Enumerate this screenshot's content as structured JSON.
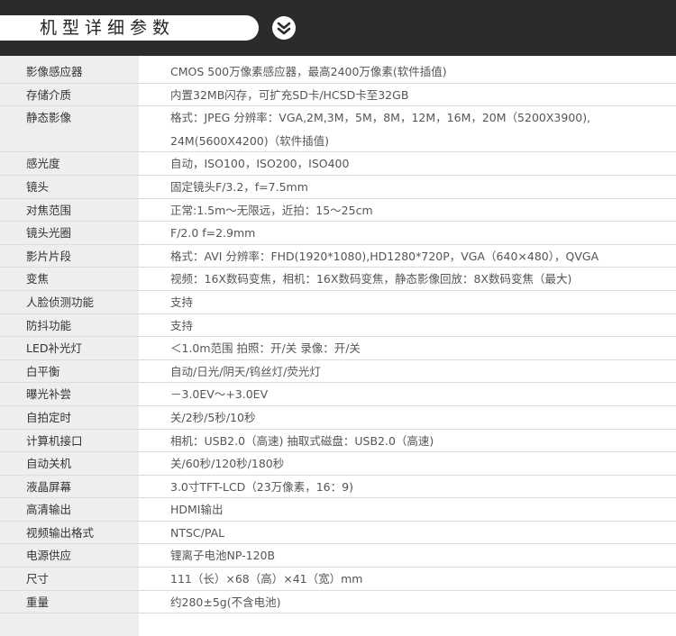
{
  "header": {
    "title": "机型详细参数",
    "chevron_icon": "double-chevron-down-icon"
  },
  "specs": [
    {
      "label": "影像感应器",
      "value": "CMOS 500万像素感应器，最高2400万像素(软件插值)"
    },
    {
      "label": "存储介质",
      "value": "内置32MB闪存，可扩充SD卡/HCSD卡至32GB"
    },
    {
      "label": "静态影像",
      "value": "格式：JPEG  分辨率：VGA,2M,3M，5M，8M，12M，16M，20M（5200X3900),\n24M(5600X4200)（软件插值)"
    },
    {
      "label": "感光度",
      "value": "自动，ISO100，ISO200，ISO400"
    },
    {
      "label": "镜头",
      "value": "固定镜头F/3.2，f=7.5mm"
    },
    {
      "label": "对焦范围",
      "value": "正常:1.5m～无限远，近拍：15～25cm"
    },
    {
      "label": "镜头光圈",
      "value": "F/2.0 f=2.9mm"
    },
    {
      "label": "影片片段",
      "value": "格式：AVI  分辨率：FHD(1920*1080),HD1280*720P，VGA（640×480），QVGA"
    },
    {
      "label": "变焦",
      "value": "视频：16X数码变焦，相机：16X数码变焦，静态影像回放：8X数码变焦（最大)"
    },
    {
      "label": "人脸侦测功能",
      "value": "支持"
    },
    {
      "label": "防抖功能",
      "value": "支持"
    },
    {
      "label": "LED补光灯",
      "value": "＜1.0m范围  拍照：开/关   录像：开/关"
    },
    {
      "label": "白平衡",
      "value": "自动/日光/阴天/钨丝灯/荧光灯"
    },
    {
      "label": "曝光补尝",
      "value": "－3.0EV～+3.0EV"
    },
    {
      "label": "自拍定时",
      "value": "关/2秒/5秒/10秒"
    },
    {
      "label": "计算机接口",
      "value": "相机：USB2.0（高速)  抽取式磁盘：USB2.0（高速)"
    },
    {
      "label": "自动关机",
      "value": "关/60秒/120秒/180秒"
    },
    {
      "label": "液晶屏幕",
      "value": "3.0寸TFT-LCD（23万像素，16：9)"
    },
    {
      "label": "高清输出",
      "value": "HDMI输出"
    },
    {
      "label": "视频输出格式",
      "value": "NTSC/PAL"
    },
    {
      "label": "电源供应",
      "value": "锂离子电池NP-120B"
    },
    {
      "label": "尺寸",
      "value": "111（长）×68（高）×41（宽）mm"
    },
    {
      "label": "重量",
      "value": "约280±5g(不含电池)"
    }
  ],
  "colors": {
    "header_bg": "#2b2b2b",
    "label_bg": "#eeeef0",
    "divider": "#dcdcdc"
  }
}
